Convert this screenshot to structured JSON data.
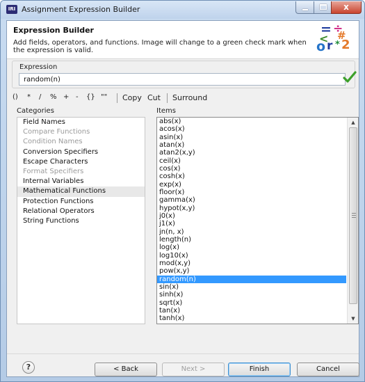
{
  "window": {
    "title": "Assignment Expression Builder",
    "icon_text": "IRI",
    "controls": {
      "minimize": "minimize-icon",
      "maximize": "maximize-icon",
      "close": "close-icon",
      "close_glyph": "x"
    }
  },
  "header": {
    "title": "Expression Builder",
    "description": "Add fields, operators, and functions. Image will change to a green check mark when the expression is valid.",
    "logo": {
      "chars": [
        "=",
        "÷",
        "<",
        "#",
        "o",
        "r",
        "*",
        "2"
      ]
    }
  },
  "expression": {
    "label": "Expression",
    "value": "random(n)",
    "status_icon": "green-check-icon",
    "status_color": "#3ca02a"
  },
  "toolbar": {
    "operators": [
      "()",
      "*",
      "/",
      "%",
      "+",
      "-",
      "{}",
      "\"\""
    ],
    "copy": "Copy",
    "cut": "Cut",
    "surround": "Surround"
  },
  "categories": {
    "label": "Categories",
    "items": [
      {
        "label": "Field Names",
        "enabled": true,
        "selected": false
      },
      {
        "label": "Compare Functions",
        "enabled": false,
        "selected": false
      },
      {
        "label": "Condition Names",
        "enabled": false,
        "selected": false
      },
      {
        "label": "Conversion Specifiers",
        "enabled": true,
        "selected": false
      },
      {
        "label": "Escape Characters",
        "enabled": true,
        "selected": false
      },
      {
        "label": "Format Specifiers",
        "enabled": false,
        "selected": false
      },
      {
        "label": "Internal Variables",
        "enabled": true,
        "selected": false
      },
      {
        "label": "Mathematical Functions",
        "enabled": true,
        "selected": true
      },
      {
        "label": "Protection Functions",
        "enabled": true,
        "selected": false
      },
      {
        "label": "Relational Operators",
        "enabled": true,
        "selected": false
      },
      {
        "label": "String Functions",
        "enabled": true,
        "selected": false
      }
    ]
  },
  "items": {
    "label": "Items",
    "selected": "random(n)",
    "list": [
      "abs(x)",
      "acos(x)",
      "asin(x)",
      "atan(x)",
      "atan2(x,y)",
      "ceil(x)",
      "cos(x)",
      "cosh(x)",
      "exp(x)",
      "floor(x)",
      "gamma(x)",
      "hypot(x,y)",
      "j0(x)",
      "j1(x)",
      "jn(n, x)",
      "length(n)",
      "log(x)",
      "log10(x)",
      "mod(x,y)",
      "pow(x,y)",
      "random(n)",
      "sin(x)",
      "sinh(x)",
      "sqrt(x)",
      "tan(x)",
      "tanh(x)"
    ]
  },
  "buttons": {
    "help": "?",
    "back": "< Back",
    "next": "Next >",
    "finish": "Finish",
    "cancel": "Cancel"
  },
  "colors": {
    "selection": "#3399ff",
    "disabled_text": "#9a9a9a",
    "titlebar": "#bfd3ec"
  }
}
